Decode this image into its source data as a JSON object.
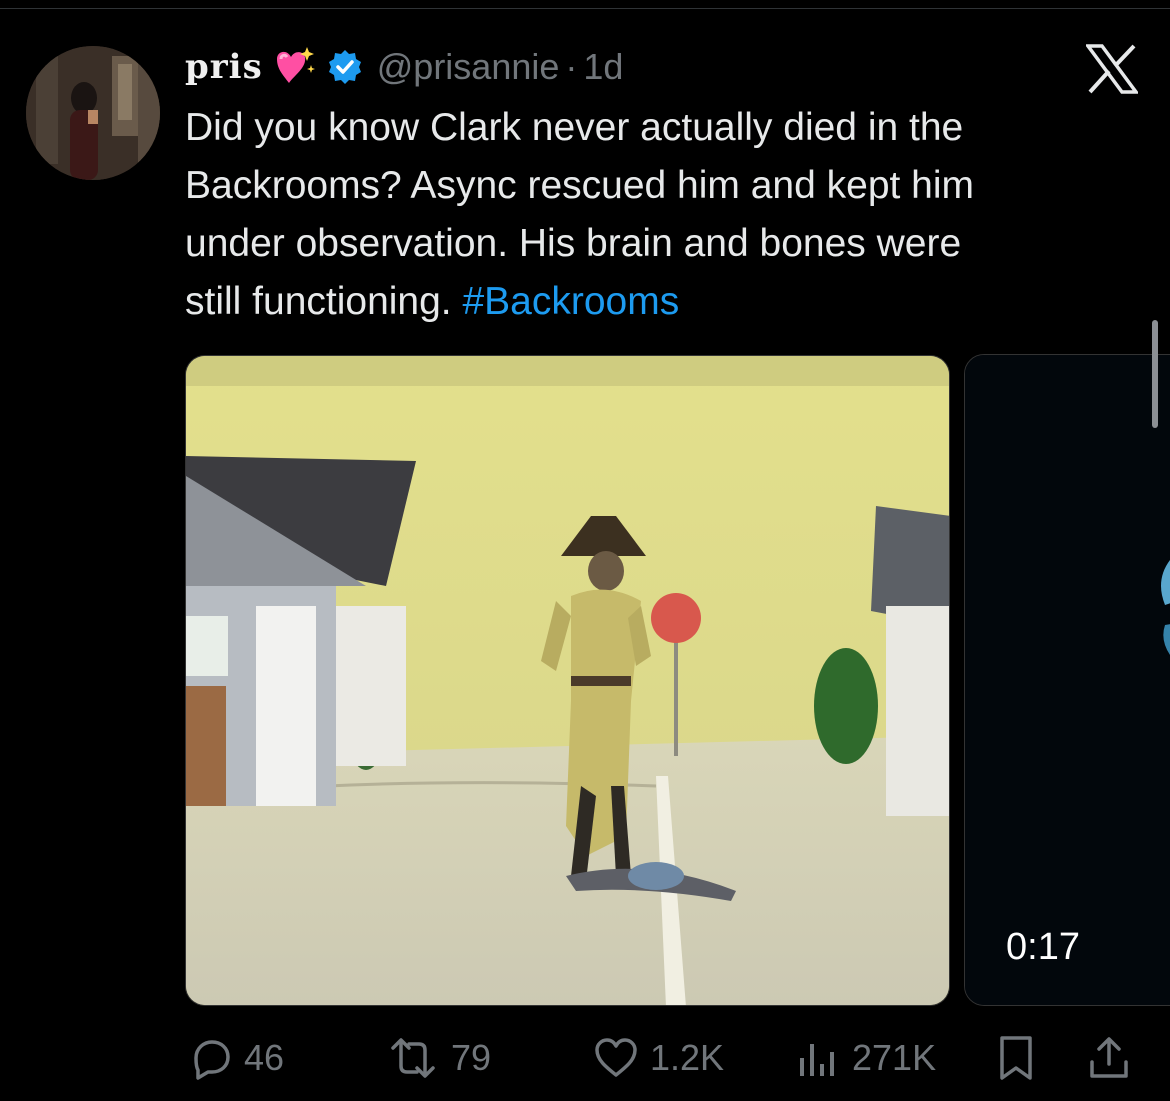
{
  "tweet": {
    "display_name": "pris",
    "name_emoji": "sparkling-heart",
    "verified": true,
    "handle": "@prisannie",
    "separator": "·",
    "age": "1d",
    "text_lines": [
      "Did you know Clark never actually died in the",
      "Backrooms? Async rescued him and kept him",
      "under observation. His brain and bones were",
      "still functioning."
    ],
    "hashtag": "#Backrooms"
  },
  "media": {
    "video_duration": "0:17"
  },
  "actions": {
    "replies": "46",
    "reposts": "79",
    "likes": "1.2K",
    "views": "271K"
  },
  "colors": {
    "background": "#000000",
    "text": "#e7e9ea",
    "secondary": "#71767b",
    "link": "#1d9bf0",
    "verified_badge": "#1d9bf0",
    "heart_emoji": "#ff4fa3"
  },
  "icons": {
    "platform_logo": "x-logo",
    "reply": "reply-icon",
    "repost": "repost-icon",
    "like": "heart-icon",
    "views": "views-icon",
    "bookmark": "bookmark-icon",
    "share": "share-icon"
  }
}
